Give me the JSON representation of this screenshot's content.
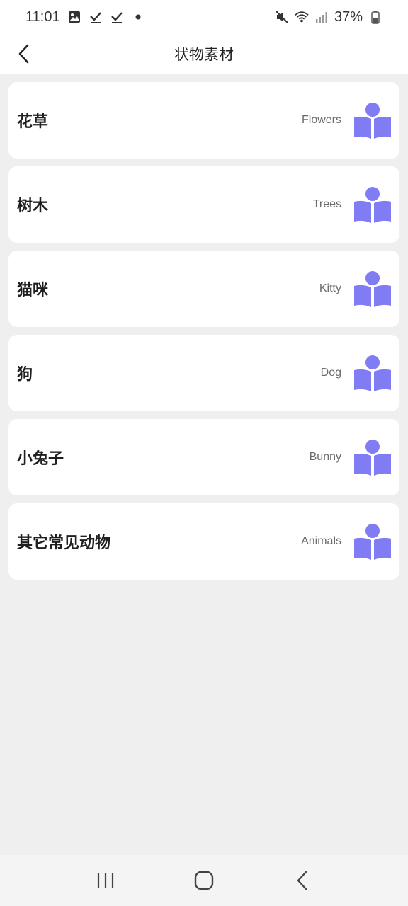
{
  "status_bar": {
    "time": "11:01",
    "battery_text": "37%",
    "left_icons": [
      "gallery-icon",
      "check-icon",
      "check-icon",
      "dot-icon"
    ],
    "right_icons": [
      "mute-icon",
      "wifi-icon",
      "signal-icon",
      "battery-icon"
    ]
  },
  "header": {
    "title": "状物素材",
    "back_icon": "chevron-left-icon"
  },
  "accent_color": "#7f7cf4",
  "items": [
    {
      "title": "花草",
      "subtitle": "Flowers"
    },
    {
      "title": "树木",
      "subtitle": "Trees"
    },
    {
      "title": "猫咪",
      "subtitle": "Kitty"
    },
    {
      "title": "狗",
      "subtitle": "Dog"
    },
    {
      "title": "小兔子",
      "subtitle": "Bunny"
    },
    {
      "title": "其它常见动物",
      "subtitle": "Animals"
    }
  ],
  "nav_bar": {
    "buttons": [
      "recent-apps-icon",
      "home-icon",
      "back-icon"
    ]
  }
}
